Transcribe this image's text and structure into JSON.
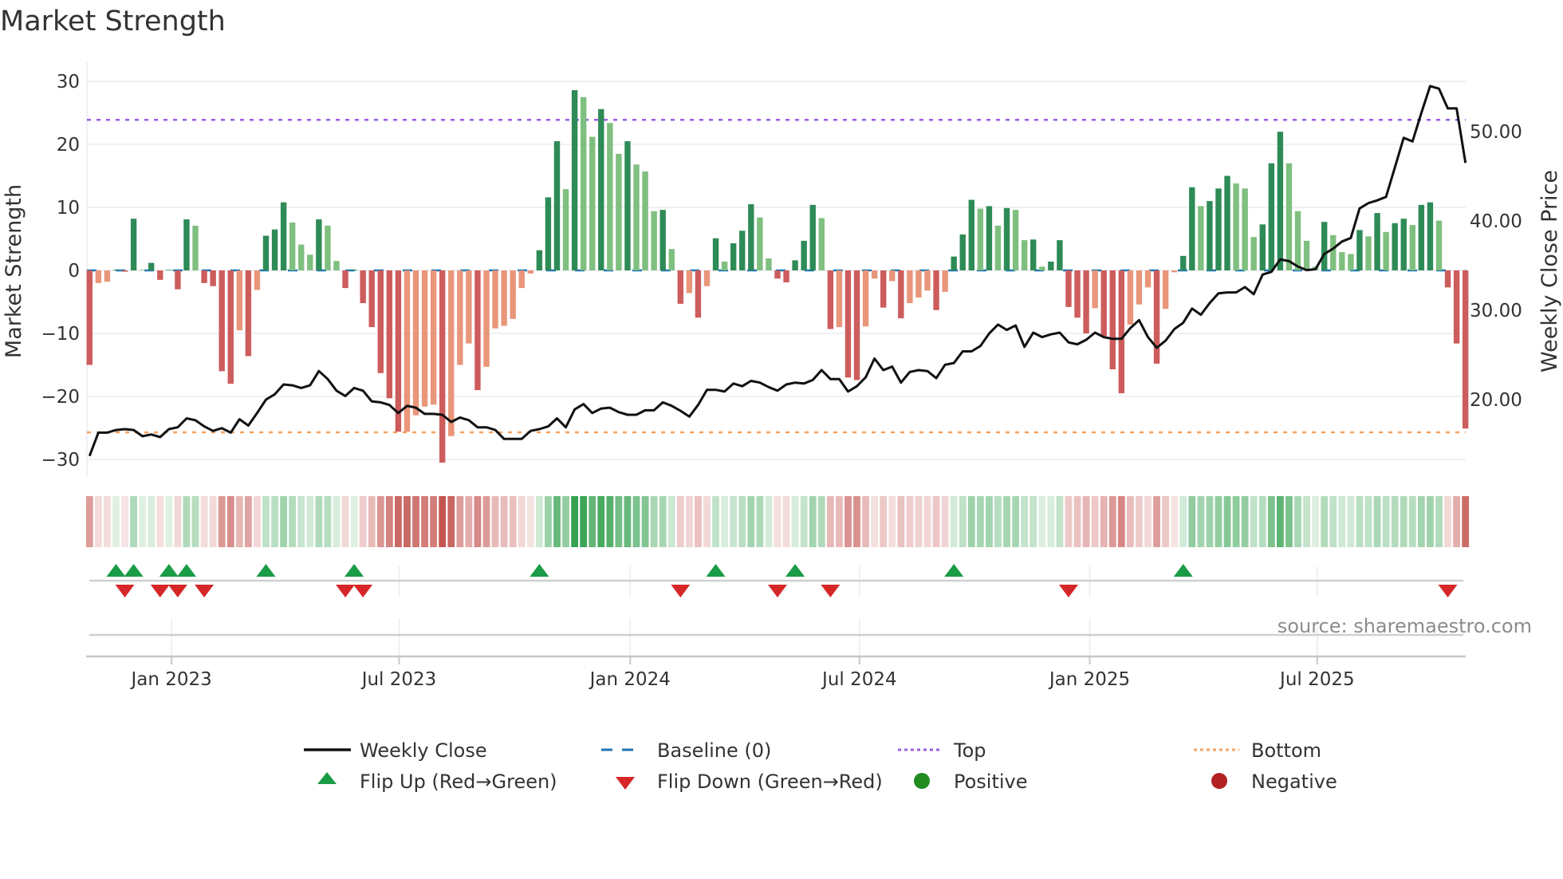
{
  "chart_data": {
    "type": "bar",
    "title": "Market Strength",
    "ylabel": "Market Strength",
    "y2label": "Weekly Close Price",
    "ylim": [
      -31,
      32
    ],
    "y2_ticks": [
      "20.00",
      "30.00",
      "40.00",
      "50.00"
    ],
    "y2_tick_values": [
      20,
      30,
      40,
      50
    ],
    "y_ticks": [
      30,
      20,
      10,
      0,
      -10,
      -20,
      -30
    ],
    "y_tick_labels": [
      "30",
      "20",
      "10",
      "0",
      "−10",
      "−20",
      "−30"
    ],
    "x_ticks": [
      {
        "label": "Jan 2023",
        "week_index": 9.3
      },
      {
        "label": "Jul 2023",
        "week_index": 35.1
      },
      {
        "label": "Jan 2024",
        "week_index": 61.3
      },
      {
        "label": "Jul 2024",
        "week_index": 87.3
      },
      {
        "label": "Jan 2025",
        "week_index": 113.4
      },
      {
        "label": "Jul 2025",
        "week_index": 139.2
      }
    ],
    "top_level": 23.9,
    "bottom_level": -25.7,
    "baseline": 0,
    "strength": [
      -15,
      -2,
      -1.8,
      0.1,
      -0.2,
      8.2,
      0.1,
      1.2,
      -1.5,
      0.1,
      -3,
      8.1,
      7.1,
      -2,
      -2.5,
      -16,
      -18,
      -9.5,
      -13.6,
      -3.1,
      5.5,
      6.5,
      10.8,
      7.6,
      4.1,
      2.5,
      8.1,
      7.1,
      1.5,
      -2.8,
      0.1,
      -5.2,
      -9,
      -16.3,
      -20.3,
      -25.6,
      -25.6,
      -23,
      -21.6,
      -21.3,
      -30.5,
      -26.3,
      -15,
      -11.6,
      -19,
      -15.3,
      -9.2,
      -8.8,
      -7.7,
      -2.8,
      -0.5,
      3.2,
      11.6,
      20.5,
      12.9,
      28.6,
      27.5,
      21.2,
      25.6,
      23.4,
      18.5,
      20.5,
      16.8,
      15.7,
      9.4,
      9.6,
      3.4,
      -5.3,
      -3.6,
      -7.5,
      -2.5,
      5.1,
      1.4,
      4.3,
      6.3,
      10.5,
      8.4,
      1.9,
      -1.3,
      -1.9,
      1.6,
      4.7,
      10.4,
      8.3,
      -9.3,
      -9,
      -17,
      -17.4,
      -8.9,
      -1.3,
      -5.9,
      -1.7,
      -7.6,
      -5.2,
      -4.3,
      -3.2,
      -6.3,
      -3.4,
      2.2,
      5.7,
      11.2,
      9.8,
      10.2,
      7.1,
      9.9,
      9.6,
      4.8,
      4.9,
      0.6,
      1.4,
      4.8,
      -5.8,
      -7.5,
      -10,
      -6,
      -10.4,
      -15.7,
      -19.5,
      -8.6,
      -5.4,
      -2.7,
      -14.8,
      -6.1,
      -0.3,
      2.3,
      13.2,
      10.2,
      11,
      13,
      15,
      13.8,
      13,
      5.3,
      7.3,
      17,
      22,
      17,
      9.4,
      4.7,
      0.6,
      7.7,
      5.6,
      2.9,
      2.6,
      6.4,
      5.4,
      9.1,
      6.1,
      7.5,
      8.2,
      7.2,
      10.4,
      10.8,
      7.9,
      -2.7,
      -11.6,
      -25.1
    ],
    "weekly_close": [
      13.7,
      16.3,
      16.3,
      16.6,
      16.7,
      16.6,
      15.9,
      16.1,
      15.8,
      16.7,
      16.9,
      17.9,
      17.7,
      17.0,
      16.5,
      16.8,
      16.3,
      17.8,
      17.1,
      18.5,
      20.0,
      20.6,
      21.7,
      21.6,
      21.3,
      21.6,
      23.2,
      22.3,
      21.0,
      20.4,
      21.3,
      21.0,
      19.8,
      19.7,
      19.4,
      18.5,
      19.3,
      19.1,
      18.4,
      18.4,
      18.3,
      17.5,
      18.0,
      17.7,
      16.9,
      16.9,
      16.6,
      15.6,
      15.6,
      15.6,
      16.5,
      16.7,
      17.0,
      17.9,
      16.9,
      18.9,
      19.5,
      18.5,
      19.0,
      19.1,
      18.6,
      18.3,
      18.3,
      18.8,
      18.8,
      19.7,
      19.3,
      18.75,
      18.1,
      19.4,
      21.1,
      21.1,
      20.9,
      21.8,
      21.5,
      22.1,
      21.9,
      21.4,
      21.0,
      21.7,
      21.9,
      21.8,
      22.2,
      23.3,
      22.3,
      22.3,
      20.9,
      21.5,
      22.5,
      24.6,
      23.3,
      23.7,
      21.9,
      23.1,
      23.3,
      23.2,
      22.4,
      23.9,
      24.1,
      25.4,
      25.4,
      26.0,
      27.4,
      28.4,
      27.8,
      28.3,
      25.9,
      27.5,
      27.0,
      27.3,
      27.5,
      26.4,
      26.2,
      26.7,
      27.5,
      27.0,
      26.8,
      26.8,
      28.0,
      28.9,
      27.0,
      25.8,
      26.6,
      27.9,
      28.6,
      30.2,
      29.5,
      30.8,
      31.9,
      32.0,
      32.0,
      32.6,
      31.8,
      34.0,
      34.3,
      35.7,
      35.5,
      34.9,
      34.5,
      34.6,
      36.3,
      36.9,
      37.7,
      38.1,
      41.4,
      42.0,
      42.3,
      42.7,
      46.0,
      49.3,
      48.9,
      52.1,
      55.1,
      54.8,
      52.6,
      52.6,
      46.5
    ],
    "legend": {
      "placement": "bottom-center",
      "items": [
        {
          "label": "Weekly Close"
        },
        {
          "label": "Baseline (0)"
        },
        {
          "label": "Top"
        },
        {
          "label": "Bottom"
        },
        {
          "label": "Flip Up (Red→Green)"
        },
        {
          "label": "Flip Down (Green→Red)"
        },
        {
          "label": "Positive"
        },
        {
          "label": "Negative"
        }
      ]
    },
    "source": "source: sharemaestro.com",
    "colors": {
      "pos_strong": "#2e8b57",
      "pos_weak": "#7fbf7f",
      "neg_strong": "#cd5c5c",
      "neg_weak": "#e9967a",
      "line": "#111111",
      "baseline": "#1f77b4",
      "top": "#9b5de5",
      "bottom": "#f4a261",
      "flip_up": "#1a9c46",
      "flip_down": "#d62728",
      "positive": "#228b22",
      "negative": "#b22222",
      "heat_pos": "#2e9e4a",
      "heat_neg": "#c4544f"
    }
  }
}
